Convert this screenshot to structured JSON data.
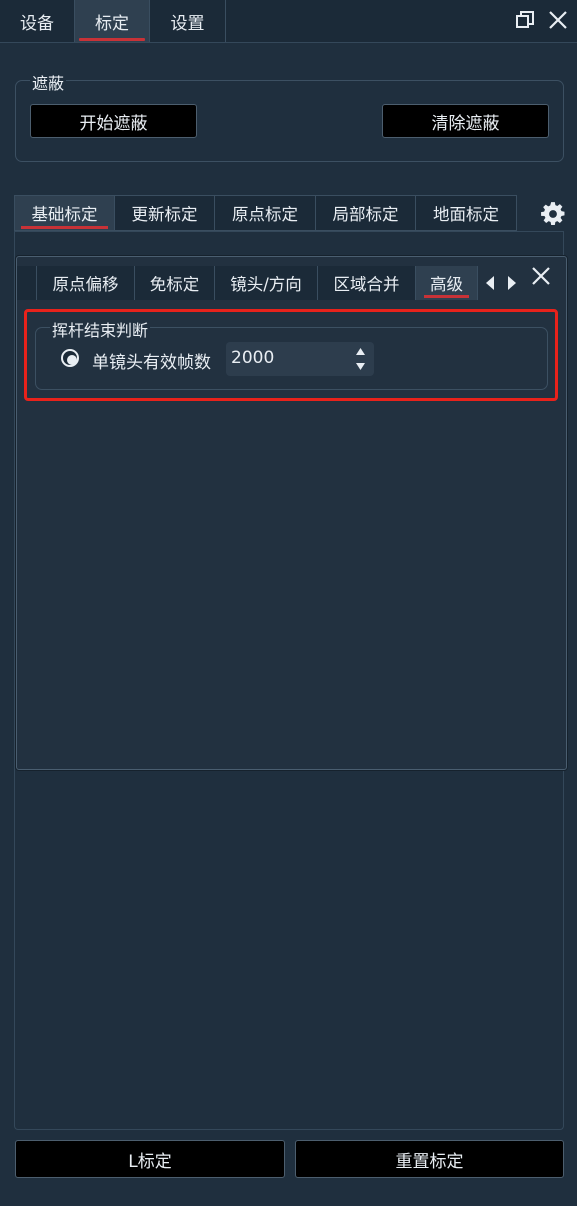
{
  "top_tabs": [
    {
      "label": "设备"
    },
    {
      "label": "标定",
      "active": true
    },
    {
      "label": "设置"
    }
  ],
  "window_controls": {
    "restore_icon": "restore-window-icon",
    "close_icon": "close-icon"
  },
  "mask_group": {
    "title": "遮蔽",
    "start_button": "开始遮蔽",
    "clear_button": "清除遮蔽"
  },
  "calib_tabs": [
    {
      "label": "基础标定",
      "active": true
    },
    {
      "label": "更新标定"
    },
    {
      "label": "原点标定"
    },
    {
      "label": "局部标定"
    },
    {
      "label": "地面标定"
    }
  ],
  "settings_icon": "gear-icon",
  "panel": {
    "tabs": [
      {
        "label": "原点偏移"
      },
      {
        "label": "免标定"
      },
      {
        "label": "镜头/方向"
      },
      {
        "label": "区域合并"
      },
      {
        "label": "高级",
        "active": true
      }
    ],
    "scroll_left_icon": "triangle-left-icon",
    "scroll_right_icon": "triangle-right-icon",
    "close_icon": "close-icon",
    "group": {
      "title": "挥杆结束判断",
      "option_label": "单镜头有效帧数",
      "option_selected": true,
      "frame_count": "2000"
    }
  },
  "bottom": {
    "l_calib": "L标定",
    "reset_calib": "重置标定"
  },
  "colors": {
    "background": "#1f2f3e",
    "active_tab": "#2f4050",
    "accent_red": "#c83237",
    "highlight_box": "#e8221b",
    "button_bg": "#000000"
  }
}
